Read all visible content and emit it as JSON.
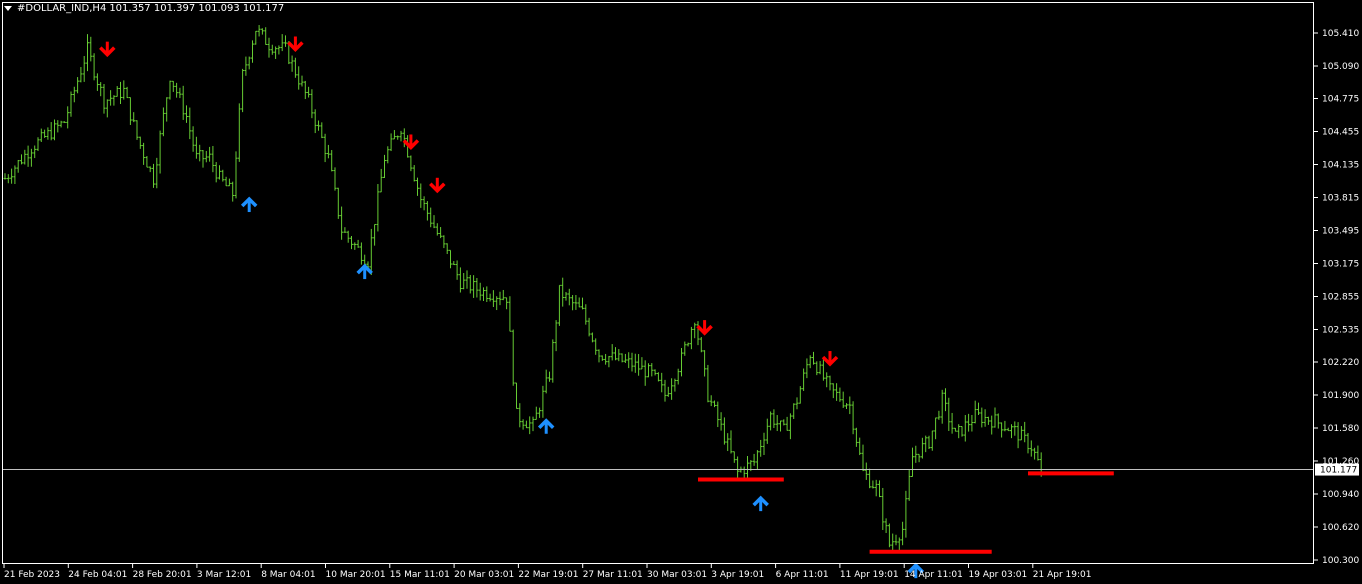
{
  "header": {
    "symbol": "#DOLLAR_IND,H4",
    "ohlc": "101.357 101.397 101.093 101.177"
  },
  "colors": {
    "background": "#000000",
    "bars": "#66cc33",
    "axis": "#ffffff",
    "down_arrow": "#ff0000",
    "up_arrow": "#1e90ff",
    "level": "#ff0000",
    "price_line": "#c0c0c0"
  },
  "chart_data": {
    "type": "ohlc",
    "current_price": 101.177,
    "current_price_label": "101.177",
    "ylim": [
      100.3,
      105.6
    ],
    "y_ticks": [
      "105.410",
      "105.090",
      "104.775",
      "104.455",
      "104.135",
      "103.815",
      "103.495",
      "103.175",
      "102.855",
      "102.535",
      "102.220",
      "101.900",
      "101.580",
      "101.260",
      "100.940",
      "100.620",
      "100.300"
    ],
    "x_ticks": [
      "21 Feb 2023",
      "24 Feb 04:01",
      "28 Feb 20:01",
      "3 Mar 12:01",
      "8 Mar 04:01",
      "10 Mar 20:01",
      "15 Mar 11:01",
      "20 Mar 03:01",
      "22 Mar 19:01",
      "27 Mar 11:01",
      "30 Mar 03:01",
      "3 Apr 19:01",
      "6 Apr 11:01",
      "11 Apr 19:01",
      "14 Apr 11:01",
      "19 Apr 03:01",
      "21 Apr 19:01"
    ],
    "bar_count": 320,
    "close_path": [
      [
        0,
        104.0
      ],
      [
        8,
        104.3
      ],
      [
        18,
        104.55
      ],
      [
        25,
        105.25
      ],
      [
        30,
        104.75
      ],
      [
        36,
        104.85
      ],
      [
        40,
        104.4
      ],
      [
        45,
        104.0
      ],
      [
        50,
        105.0
      ],
      [
        55,
        104.6
      ],
      [
        58,
        104.2
      ],
      [
        62,
        104.2
      ],
      [
        65,
        104.0
      ],
      [
        69,
        103.85
      ],
      [
        72,
        105.0
      ],
      [
        76,
        105.45
      ],
      [
        80,
        105.3
      ],
      [
        85,
        105.25
      ],
      [
        92,
        104.75
      ],
      [
        98,
        104.2
      ],
      [
        102,
        103.5
      ],
      [
        110,
        103.2
      ],
      [
        115,
        104.2
      ],
      [
        120,
        104.5
      ],
      [
        126,
        103.8
      ],
      [
        132,
        103.4
      ],
      [
        138,
        103.0
      ],
      [
        145,
        102.9
      ],
      [
        152,
        102.85
      ],
      [
        155,
        101.7
      ],
      [
        160,
        101.6
      ],
      [
        165,
        102.1
      ],
      [
        168,
        102.9
      ],
      [
        175,
        102.7
      ],
      [
        180,
        102.3
      ],
      [
        190,
        102.2
      ],
      [
        196,
        102.1
      ],
      [
        200,
        101.9
      ],
      [
        205,
        102.25
      ],
      [
        209,
        102.65
      ],
      [
        213,
        101.9
      ],
      [
        218,
        101.5
      ],
      [
        222,
        101.15
      ],
      [
        227,
        101.25
      ],
      [
        232,
        101.7
      ],
      [
        236,
        101.55
      ],
      [
        240,
        101.85
      ],
      [
        244,
        102.3
      ],
      [
        250,
        101.95
      ],
      [
        256,
        101.8
      ],
      [
        260,
        101.15
      ],
      [
        264,
        101.0
      ],
      [
        268,
        100.45
      ],
      [
        272,
        100.6
      ],
      [
        275,
        101.3
      ],
      [
        280,
        101.45
      ],
      [
        284,
        101.85
      ],
      [
        288,
        101.5
      ],
      [
        294,
        101.7
      ],
      [
        300,
        101.65
      ],
      [
        306,
        101.55
      ],
      [
        311,
        101.4
      ],
      [
        314,
        101.177
      ]
    ],
    "signals": [
      {
        "type": "sell",
        "bar": 31,
        "price": 105.2
      },
      {
        "type": "sell",
        "bar": 88,
        "price": 105.25
      },
      {
        "type": "sell",
        "bar": 123,
        "price": 104.3
      },
      {
        "type": "sell",
        "bar": 131,
        "price": 103.88
      },
      {
        "type": "sell",
        "bar": 212,
        "price": 102.5
      },
      {
        "type": "sell",
        "bar": 250,
        "price": 102.2
      },
      {
        "type": "buy",
        "bar": 74,
        "price": 103.8
      },
      {
        "type": "buy",
        "bar": 109,
        "price": 103.15
      },
      {
        "type": "buy",
        "bar": 164,
        "price": 101.65
      },
      {
        "type": "buy",
        "bar": 229,
        "price": 100.9
      },
      {
        "type": "buy",
        "bar": 276,
        "price": 100.25
      }
    ],
    "levels": [
      {
        "from_bar": 210,
        "to_bar": 236,
        "price": 101.08
      },
      {
        "from_bar": 262,
        "to_bar": 299,
        "price": 100.38
      },
      {
        "from_bar": 310,
        "to_bar": 336,
        "price": 101.14
      }
    ],
    "grid": false
  }
}
